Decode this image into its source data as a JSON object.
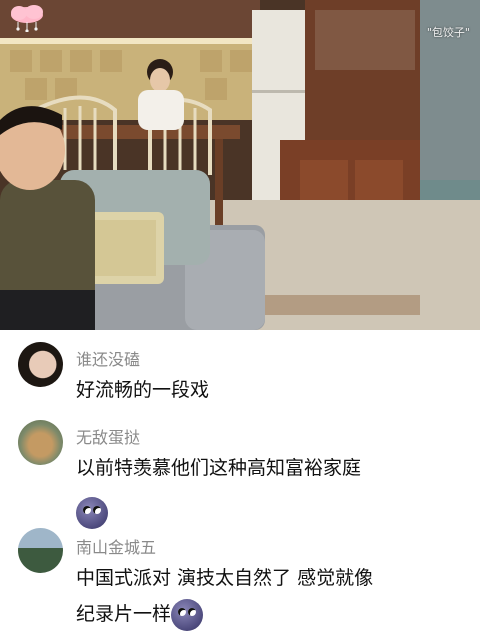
{
  "watermark": {
    "tag": "\"包饺子\""
  },
  "comments": [
    {
      "username": "谁还没磕",
      "lines": [
        "好流畅的一段戏"
      ],
      "emoji": null
    },
    {
      "username": "无敌蛋挞",
      "lines": [
        "以前特羡慕他们这种高知富裕家庭"
      ],
      "emoji": "purple-face-emoji"
    },
    {
      "username": "南山金城五",
      "lines": [
        "中国式派对 演技太自然了 感觉就像",
        "纪录片一样"
      ],
      "emoji": "purple-face-emoji"
    }
  ]
}
